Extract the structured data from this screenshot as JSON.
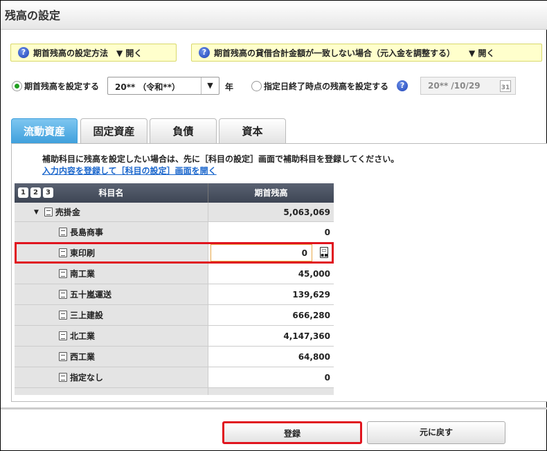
{
  "title": "残高の設定",
  "help": [
    {
      "label": "期首残高の設定方法",
      "toggle": "▼ 開く"
    },
    {
      "label": "期首残高の貸借合計金額が一致しない場合（元入金を調整する）",
      "toggle": "▼ 開く"
    }
  ],
  "options": {
    "opening_label": "期首残高を設定する",
    "year_value": "20** （令和**）",
    "year_unit": "年",
    "date_label": "指定日終了時点の残高を設定する",
    "date_value": "20** /10/29",
    "calendar_day": "31"
  },
  "tabs": [
    "流動資産",
    "固定資産",
    "負債",
    "資本"
  ],
  "note": "補助科目に残高を設定したい場合は、先に［科目の設定］画面で補助科目を登録してください。",
  "link": "入力内容を登録して［科目の設定］画面を開く",
  "table": {
    "levels": [
      "1",
      "2",
      "3"
    ],
    "headers": [
      "科目名",
      "期首残高"
    ],
    "parent": {
      "name": "売掛金",
      "value": "5,063,069"
    },
    "rows": [
      {
        "name": "長島商事",
        "value": "0"
      },
      {
        "name": "東印刷",
        "value": "0"
      },
      {
        "name": "南工業",
        "value": "45,000"
      },
      {
        "name": "五十嵐運送",
        "value": "139,629"
      },
      {
        "name": "三上建設",
        "value": "666,280"
      },
      {
        "name": "北工業",
        "value": "4,147,360"
      },
      {
        "name": "西工業",
        "value": "64,800"
      },
      {
        "name": "指定なし",
        "value": "0"
      }
    ]
  },
  "buttons": {
    "save": "登録",
    "revert": "元に戻す"
  },
  "colors": {
    "highlight": "#e0141e",
    "active_tab": "#3e9fdc",
    "help_bg": "#ffffcc"
  }
}
